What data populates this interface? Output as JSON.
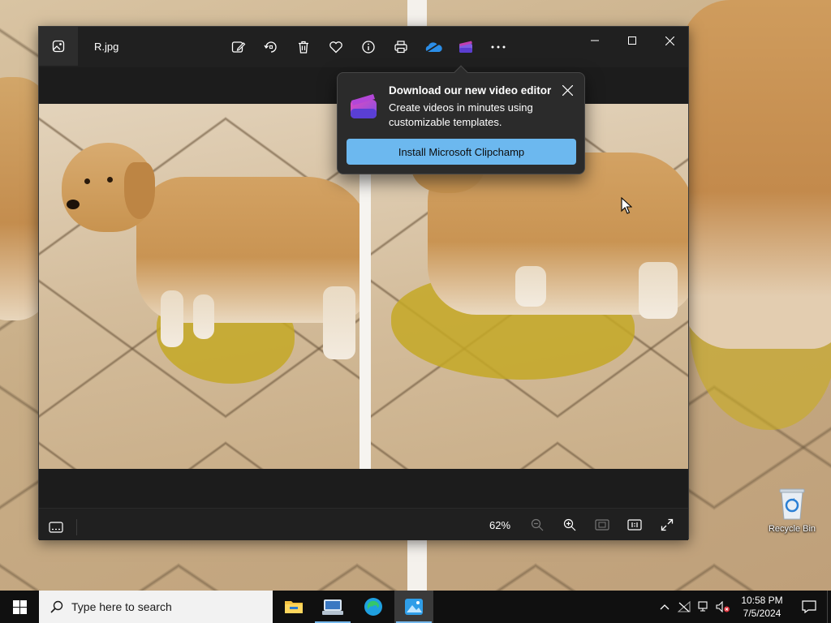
{
  "window": {
    "file_name": "R.jpg",
    "toolbar": [
      "edit-image-icon",
      "rotate-icon",
      "delete-icon",
      "favorite-icon",
      "info-icon",
      "print-icon",
      "onedrive-icon",
      "clipchamp-icon",
      "more-icon"
    ]
  },
  "statusbar": {
    "zoom_level": "62%"
  },
  "tip": {
    "title": "Download our new video editor",
    "body": "Create videos in minutes using customizable templates.",
    "install_label": "Install Microsoft Clipchamp"
  },
  "desktop": {
    "recycle_bin_label": "Recycle Bin"
  },
  "taskbar": {
    "search_placeholder": "Type here to search",
    "time": "10:58 PM",
    "date": "7/5/2024",
    "apps": [
      "file-explorer-icon",
      "pinned-app-icon",
      "edge-icon",
      "photos-icon"
    ]
  },
  "colors": {
    "accent": "#6cb8ef",
    "window_bg": "#1c1c1c",
    "taskbar_bg": "#101010"
  }
}
